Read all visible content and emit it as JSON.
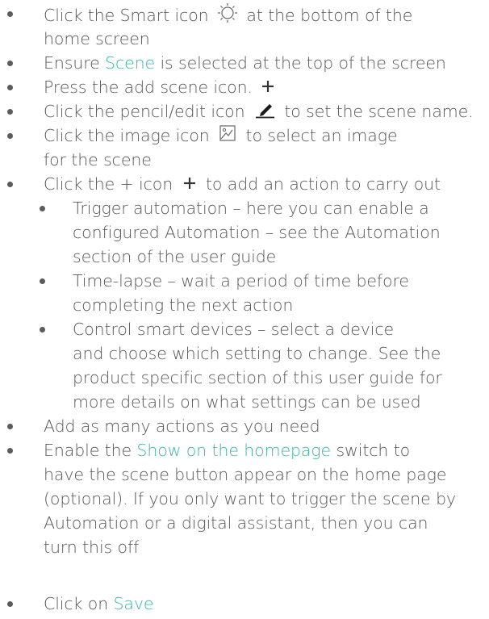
{
  "accent_color": "#39b4ae",
  "icons": {
    "smart": "smart-sun-icon",
    "add_scene": "plus-icon",
    "edit": "pencil-icon",
    "image": "image-icon",
    "add_action": "plus-icon"
  },
  "steps": [
    {
      "pre": "Click the Smart icon",
      "post": "at the bottom of the",
      "line2": "home screen"
    },
    {
      "pre": "Ensure ",
      "highlight": "Scene",
      "post": " is selected at the top of the screen"
    },
    {
      "pre": "Press the add scene icon."
    },
    {
      "pre": "Click the pencil/edit icon",
      "post": "to set the scene name."
    },
    {
      "pre": "Click the image icon",
      "post": "to select an image",
      "line2": "for the scene"
    },
    {
      "pre": "Click the + icon",
      "post": "to add an action to carry out"
    }
  ],
  "sub_steps": [
    {
      "lines": [
        "Trigger automation – here you can enable a",
        "configured Automation – see the Automation",
        "section of the user guide"
      ]
    },
    {
      "lines": [
        "Time-lapse – wait a period of time before",
        "completing the next action"
      ]
    },
    {
      "lines": [
        "Control smart devices – select a device",
        "and choose which setting to change. See the",
        "product specific section of this user guide for",
        "more details on what settings can be used"
      ]
    }
  ],
  "steps_after": [
    {
      "lines": [
        "Add as many actions as you need"
      ]
    },
    {
      "pre": "Enable the ",
      "highlight": "Show on the homepage",
      "post": " switch to",
      "lines": [
        "have the scene button appear on the home page",
        "(optional). If you only want to trigger the scene by",
        "Automation or a digital assistant, then you can",
        "turn this off"
      ]
    },
    {
      "pre": "Click on ",
      "highlight": "Save"
    }
  ]
}
